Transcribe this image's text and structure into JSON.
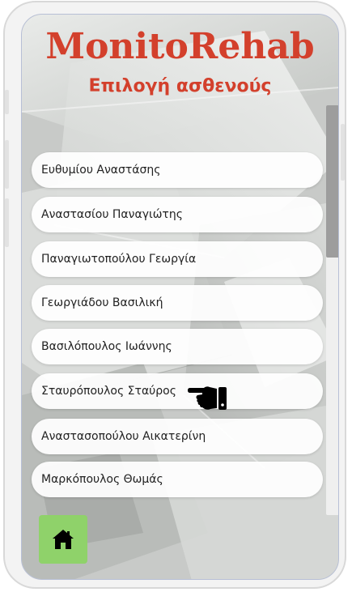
{
  "app": {
    "title": "MonitoRehab",
    "subtitle": "Επιλογή ασθενούς"
  },
  "patients": [
    {
      "label": "Ευθυμίου Αναστάσης"
    },
    {
      "label": "Αναστασίου Παναγιώτης"
    },
    {
      "label": "Παναγιωτοπούλου Γεωργία"
    },
    {
      "label": "Γεωργιάδου Βασιλική"
    },
    {
      "label": "Βασιλόπουλος Ιωάννης"
    },
    {
      "label": "Σταυρόπουλος Σταύρος"
    },
    {
      "label": "Αναστασοπούλου Αικατερίνη"
    },
    {
      "label": "Μαρκόπουλος Θωμάς"
    }
  ],
  "footer": {
    "home_icon": "home-icon"
  },
  "colors": {
    "title": "#d3402c",
    "home_button": "#8fd26a"
  }
}
